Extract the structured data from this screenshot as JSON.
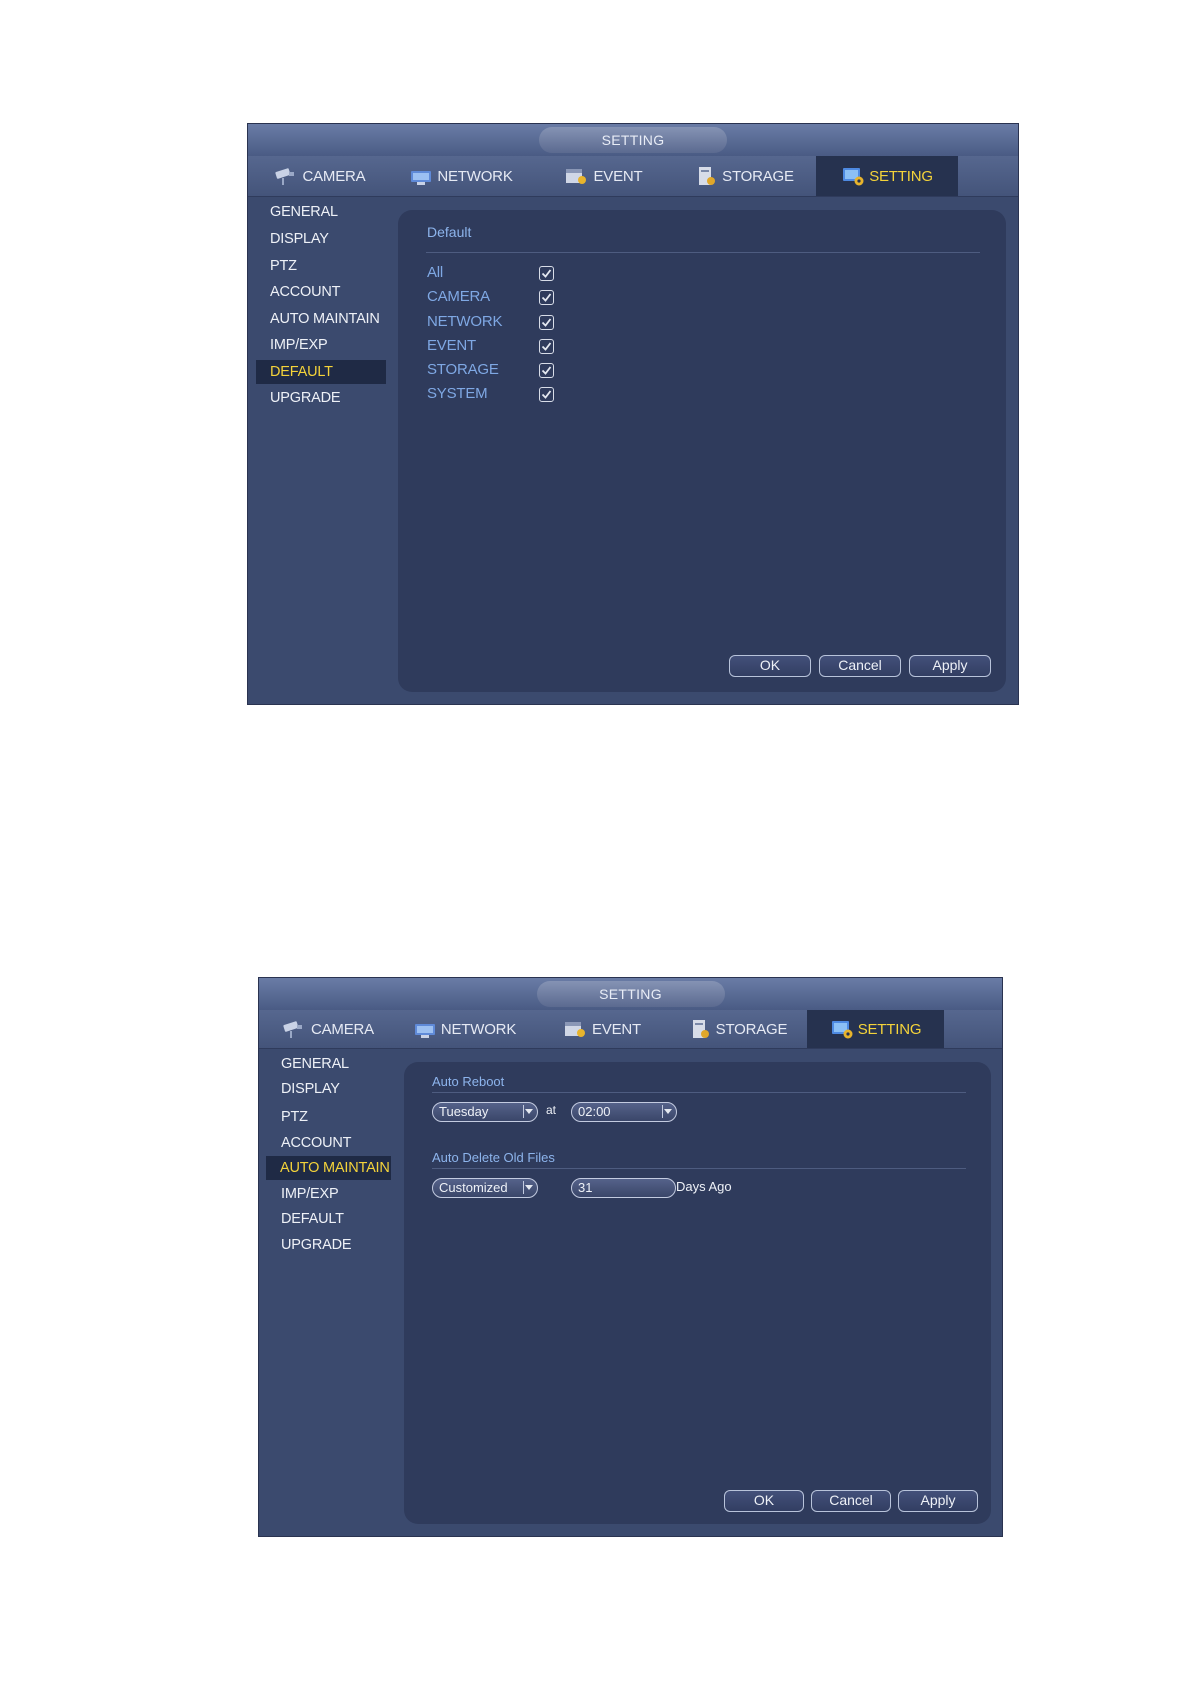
{
  "window1": {
    "title": "SETTING",
    "tabs": [
      {
        "label": "CAMERA",
        "icon": "camera-icon"
      },
      {
        "label": "NETWORK",
        "icon": "network-icon"
      },
      {
        "label": "EVENT",
        "icon": "event-icon"
      },
      {
        "label": "STORAGE",
        "icon": "storage-icon"
      },
      {
        "label": "SETTING",
        "icon": "setting-icon",
        "active": true
      }
    ],
    "sidebar": [
      "GENERAL",
      "DISPLAY",
      "PTZ",
      "ACCOUNT",
      "AUTO MAINTAIN",
      "IMP/EXP",
      "DEFAULT",
      "UPGRADE"
    ],
    "sidebar_active": "DEFAULT",
    "section_title": "Default",
    "checkboxes": [
      {
        "label": "All",
        "checked": true
      },
      {
        "label": "CAMERA",
        "checked": true
      },
      {
        "label": "NETWORK",
        "checked": true
      },
      {
        "label": "EVENT",
        "checked": true
      },
      {
        "label": "STORAGE",
        "checked": true
      },
      {
        "label": "SYSTEM",
        "checked": true
      }
    ],
    "buttons": {
      "ok": "OK",
      "cancel": "Cancel",
      "apply": "Apply"
    }
  },
  "window2": {
    "title": "SETTING",
    "tabs": [
      {
        "label": "CAMERA",
        "icon": "camera-icon"
      },
      {
        "label": "NETWORK",
        "icon": "network-icon"
      },
      {
        "label": "EVENT",
        "icon": "event-icon"
      },
      {
        "label": "STORAGE",
        "icon": "storage-icon"
      },
      {
        "label": "SETTING",
        "icon": "setting-icon",
        "active": true
      }
    ],
    "sidebar": [
      "GENERAL",
      "DISPLAY",
      "PTZ",
      "ACCOUNT",
      "AUTO MAINTAIN",
      "IMP/EXP",
      "DEFAULT",
      "UPGRADE"
    ],
    "sidebar_active": "AUTO MAINTAIN",
    "auto_reboot": {
      "title": "Auto Reboot",
      "day_value": "Tuesday",
      "at_label": "at",
      "time_value": "02:00"
    },
    "auto_delete": {
      "title": "Auto Delete Old Files",
      "mode_value": "Customized",
      "days_value": "31",
      "suffix": "Days Ago"
    },
    "buttons": {
      "ok": "OK",
      "cancel": "Cancel",
      "apply": "Apply"
    }
  },
  "colors": {
    "window_bg": "#3b4a6e",
    "panel_bg": "#2f3b5c",
    "active_text": "#f4d33a",
    "label_blue": "#7fa8e4"
  }
}
